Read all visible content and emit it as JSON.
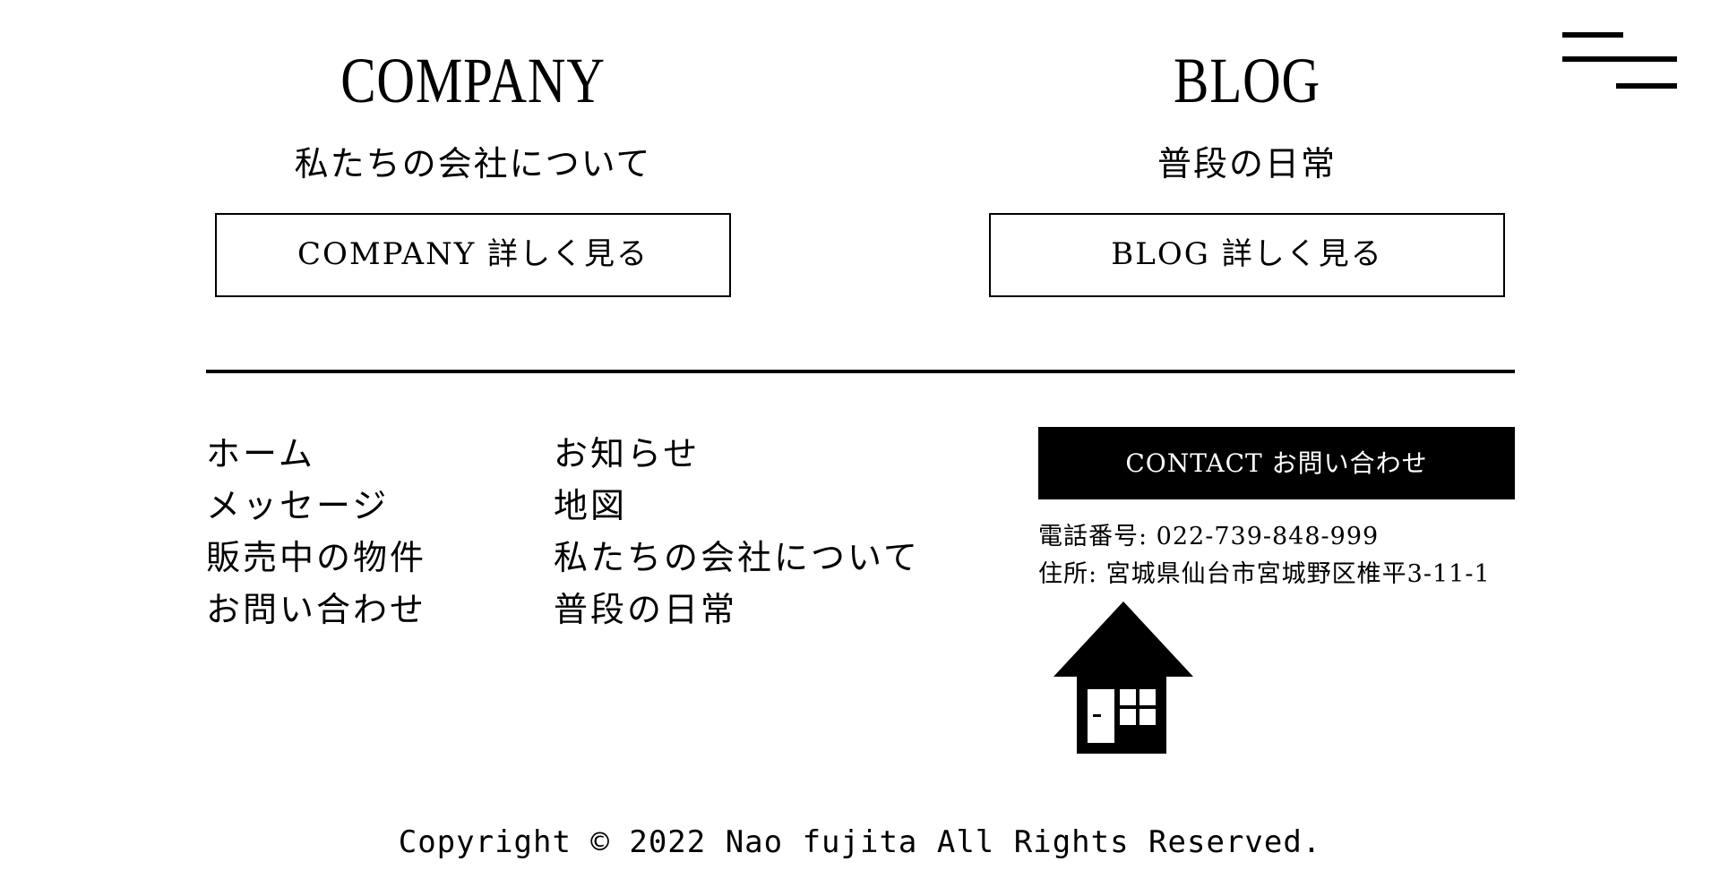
{
  "header": {
    "menu_icon": "hamburger-menu-icon"
  },
  "company": {
    "title": "COMPANY",
    "subtitle": "私たちの会社について",
    "button_label": "COMPANY 詳しく見る"
  },
  "blog": {
    "title": "BLOG",
    "subtitle": "普段の日常",
    "button_label": "BLOG 詳しく見る"
  },
  "footer": {
    "nav_col1": [
      {
        "label": "ホーム"
      },
      {
        "label": "メッセージ"
      },
      {
        "label": "販売中の物件"
      },
      {
        "label": "お問い合わせ"
      }
    ],
    "nav_col2": [
      {
        "label": "お知らせ"
      },
      {
        "label": "地図"
      },
      {
        "label": "私たちの会社について"
      },
      {
        "label": "普段の日常"
      }
    ],
    "contact_label": "CONTACT お問い合わせ",
    "tel": "電話番号: 022-739-848-999",
    "address": "住所: 宮城県仙台市宮城野区椎平3-11-1",
    "house_icon": "house-icon",
    "copyright": "Copyright © 2022 Nao fujita All Rights Reserved."
  },
  "colors": {
    "background": "#ffffff",
    "foreground": "#000000"
  }
}
